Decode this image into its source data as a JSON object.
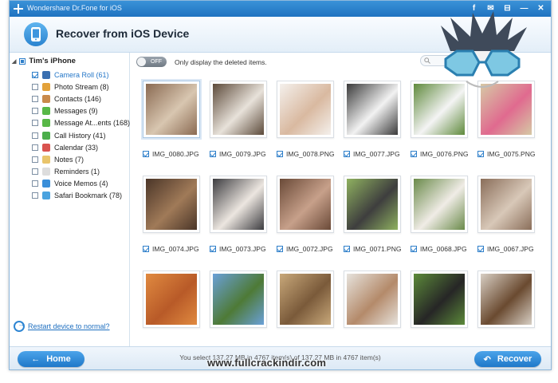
{
  "window": {
    "app_title": "Wondershare Dr.Fone for iOS",
    "page_title": "Recover from iOS Device"
  },
  "sidebar": {
    "device_name": "Tim's iPhone",
    "items": [
      {
        "label": "Camera Roll (61)",
        "checked": true,
        "selected": true,
        "icon": "camera-roll-icon",
        "color": "#3a6fb0"
      },
      {
        "label": "Photo Stream (8)",
        "checked": false,
        "icon": "photo-stream-icon",
        "color": "#e3a23a"
      },
      {
        "label": "Contacts (146)",
        "checked": false,
        "icon": "contacts-icon",
        "color": "#c98a4b"
      },
      {
        "label": "Messages (9)",
        "checked": false,
        "icon": "messages-icon",
        "color": "#58b847"
      },
      {
        "label": "Message At...ents (168)",
        "checked": false,
        "icon": "message-attachments-icon",
        "color": "#58b847"
      },
      {
        "label": "Call History (41)",
        "checked": false,
        "icon": "call-history-icon",
        "color": "#4cae4c"
      },
      {
        "label": "Calendar (33)",
        "checked": false,
        "icon": "calendar-icon",
        "color": "#d9534f"
      },
      {
        "label": "Notes (7)",
        "checked": false,
        "icon": "notes-icon",
        "color": "#e9c46a"
      },
      {
        "label": "Reminders (1)",
        "checked": false,
        "icon": "reminders-icon",
        "color": "#dddddd"
      },
      {
        "label": "Voice Memos (4)",
        "checked": false,
        "icon": "voice-memos-icon",
        "color": "#3b8fd9"
      },
      {
        "label": "Safari Bookmark (78)",
        "checked": false,
        "icon": "safari-bookmark-icon",
        "color": "#4aa3df"
      }
    ],
    "restart_link": "Restart device to normal?"
  },
  "toolbar": {
    "toggle_label": "OFF",
    "only_deleted": "Only display the deleted items."
  },
  "photos": [
    {
      "name": "IMG_0080.JPG",
      "colors": [
        "#8a6a52",
        "#d8c6b0"
      ]
    },
    {
      "name": "IMG_0079.JPG",
      "colors": [
        "#5c4a3a",
        "#e8e2da"
      ]
    },
    {
      "name": "IMG_0078.PNG",
      "colors": [
        "#f4f0ec",
        "#d9b9a0"
      ]
    },
    {
      "name": "IMG_0077.JPG",
      "colors": [
        "#3a3a3a",
        "#f2f2f2"
      ]
    },
    {
      "name": "IMG_0076.PNG",
      "colors": [
        "#5f8a3c",
        "#f4f4f4"
      ]
    },
    {
      "name": "IMG_0075.PNG",
      "colors": [
        "#d6c9a5",
        "#e06a8f"
      ]
    },
    {
      "name": "IMG_0074.JPG",
      "colors": [
        "#4a3528",
        "#a07a58"
      ]
    },
    {
      "name": "IMG_0073.JPG",
      "colors": [
        "#3c3c40",
        "#ece6e0"
      ]
    },
    {
      "name": "IMG_0072.JPG",
      "colors": [
        "#6a4a38",
        "#c7a08a"
      ]
    },
    {
      "name": "IMG_0071.PNG",
      "colors": [
        "#8fb160",
        "#3e3e3e"
      ]
    },
    {
      "name": "IMG_0068.JPG",
      "colors": [
        "#6a8a4a",
        "#f0ece6"
      ]
    },
    {
      "name": "IMG_0067.JPG",
      "colors": [
        "#8a6e5a",
        "#d8c8b8"
      ]
    },
    {
      "name": "",
      "colors": [
        "#e08a40",
        "#b85a28"
      ]
    },
    {
      "name": "",
      "colors": [
        "#6aa0d8",
        "#4e7a36"
      ]
    },
    {
      "name": "",
      "colors": [
        "#c8a87a",
        "#7a5a3a"
      ]
    },
    {
      "name": "",
      "colors": [
        "#e6e2dc",
        "#b48a6a"
      ]
    },
    {
      "name": "",
      "colors": [
        "#5c8a3a",
        "#262626"
      ]
    },
    {
      "name": "",
      "colors": [
        "#d8cfc4",
        "#6a4a30"
      ]
    }
  ],
  "footer": {
    "home_label": "Home",
    "recover_label": "Recover",
    "status": "You select 137.27 MB in 4767 item(s) of 137.27 MB in 4767 item(s)"
  },
  "watermark": "www.fullcrackindir.com",
  "colors": {
    "accent": "#2577c8",
    "titlebar": "#1f73c0"
  }
}
